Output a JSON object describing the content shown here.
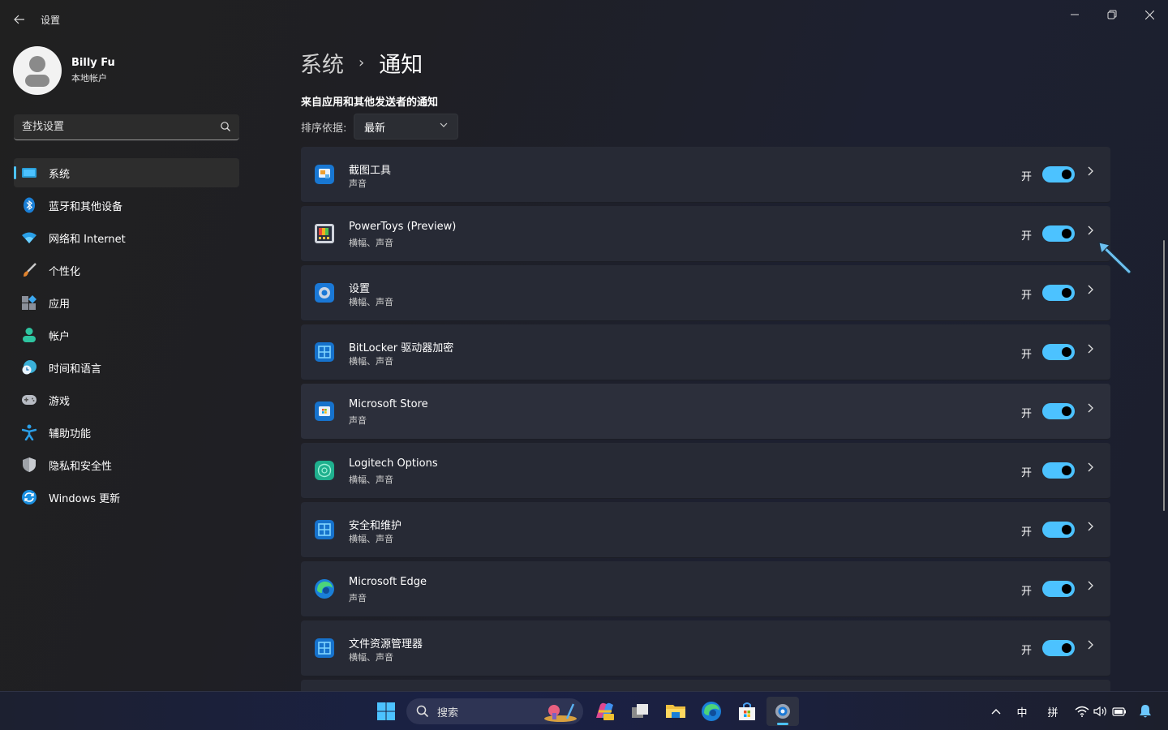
{
  "window": {
    "app_title": "设置",
    "controls": {
      "minimize": "minimize",
      "maximize": "restore",
      "close": "close"
    }
  },
  "profile": {
    "name": "Billy Fu",
    "account_type": "本地帐户"
  },
  "search": {
    "placeholder": "查找设置",
    "value": ""
  },
  "sidebar": {
    "items": [
      {
        "label": "系统",
        "icon": "system-display-icon",
        "active": true
      },
      {
        "label": "蓝牙和其他设备",
        "icon": "bluetooth-icon",
        "active": false
      },
      {
        "label": "网络和 Internet",
        "icon": "wifi-icon",
        "active": false
      },
      {
        "label": "个性化",
        "icon": "paintbrush-icon",
        "active": false
      },
      {
        "label": "应用",
        "icon": "apps-icon",
        "active": false
      },
      {
        "label": "帐户",
        "icon": "account-icon",
        "active": false
      },
      {
        "label": "时间和语言",
        "icon": "time-language-icon",
        "active": false
      },
      {
        "label": "游戏",
        "icon": "gamepad-icon",
        "active": false
      },
      {
        "label": "辅助功能",
        "icon": "accessibility-icon",
        "active": false
      },
      {
        "label": "隐私和安全性",
        "icon": "shield-icon",
        "active": false
      },
      {
        "label": "Windows 更新",
        "icon": "windows-update-icon",
        "active": false
      }
    ]
  },
  "main": {
    "breadcrumb": {
      "parent": "系统",
      "separator": "›",
      "current": "通知"
    },
    "section_title": "来自应用和其他发送者的通知",
    "sort": {
      "label": "排序依据:",
      "selected": "最新"
    },
    "apps": [
      {
        "name": "截图工具",
        "detail": "声音",
        "state": "开",
        "enabled": true,
        "icon": "snipping-tool-icon"
      },
      {
        "name": "PowerToys (Preview)",
        "detail": "横幅、声音",
        "state": "开",
        "enabled": true,
        "icon": "powertoys-icon"
      },
      {
        "name": "设置",
        "detail": "横幅、声音",
        "state": "开",
        "enabled": true,
        "icon": "settings-app-icon"
      },
      {
        "name": "BitLocker 驱动器加密",
        "detail": "横幅、声音",
        "state": "开",
        "enabled": true,
        "icon": "bitlocker-icon"
      },
      {
        "name": "Microsoft Store",
        "detail": "声音",
        "state": "开",
        "enabled": true,
        "icon": "microsoft-store-icon"
      },
      {
        "name": "Logitech Options",
        "detail": "横幅、声音",
        "state": "开",
        "enabled": true,
        "icon": "logitech-options-icon"
      },
      {
        "name": "安全和维护",
        "detail": "横幅、声音",
        "state": "开",
        "enabled": true,
        "icon": "security-maintenance-icon"
      },
      {
        "name": "Microsoft Edge",
        "detail": "声音",
        "state": "开",
        "enabled": true,
        "icon": "edge-icon"
      },
      {
        "name": "文件资源管理器",
        "detail": "横幅、声音",
        "state": "开",
        "enabled": true,
        "icon": "file-explorer-icon"
      }
    ]
  },
  "taskbar": {
    "search_label": "搜索",
    "pinned": [
      "start-icon",
      "copilot-icon",
      "task-view-icon",
      "file-explorer-icon",
      "edge-icon",
      "microsoft-store-icon",
      "settings-icon"
    ],
    "tray": {
      "ime_mode": "中",
      "ime_type": "拼"
    }
  },
  "colors": {
    "accent": "#4cc2ff",
    "window_bg": "#202020",
    "card_bg": "#272a35"
  }
}
